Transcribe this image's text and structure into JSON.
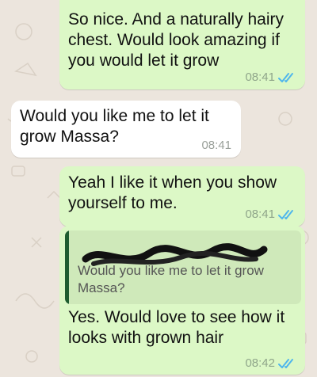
{
  "colors": {
    "wallpaper": "#ECE5DD",
    "outgoing_bubble": "#DCF8C6",
    "incoming_bubble": "#FFFFFF",
    "read_ticks": "#4FB6EC",
    "quote_bar": "#1e5d2f"
  },
  "messages": [
    {
      "direction": "outgoing",
      "text": "So nice. And a naturally hairy\nchest. Would look amazing if\nyou would let it grow",
      "time": "08:41",
      "status_icon": "double-check-read-icon"
    },
    {
      "direction": "incoming",
      "text": "Would you like me to let it\ngrow Massa?",
      "time": "08:41"
    },
    {
      "direction": "outgoing",
      "text": "Yeah I like it when you show\nyourself to me.",
      "time": "08:41",
      "status_icon": "double-check-read-icon"
    },
    {
      "direction": "outgoing",
      "quote": {
        "author_redacted": true,
        "text": "Would you like me to let it grow\nMassa?"
      },
      "text": "Yes. Would love to see how it\nlooks with grown hair",
      "time": "08:42",
      "status_icon": "double-check-read-icon"
    }
  ]
}
